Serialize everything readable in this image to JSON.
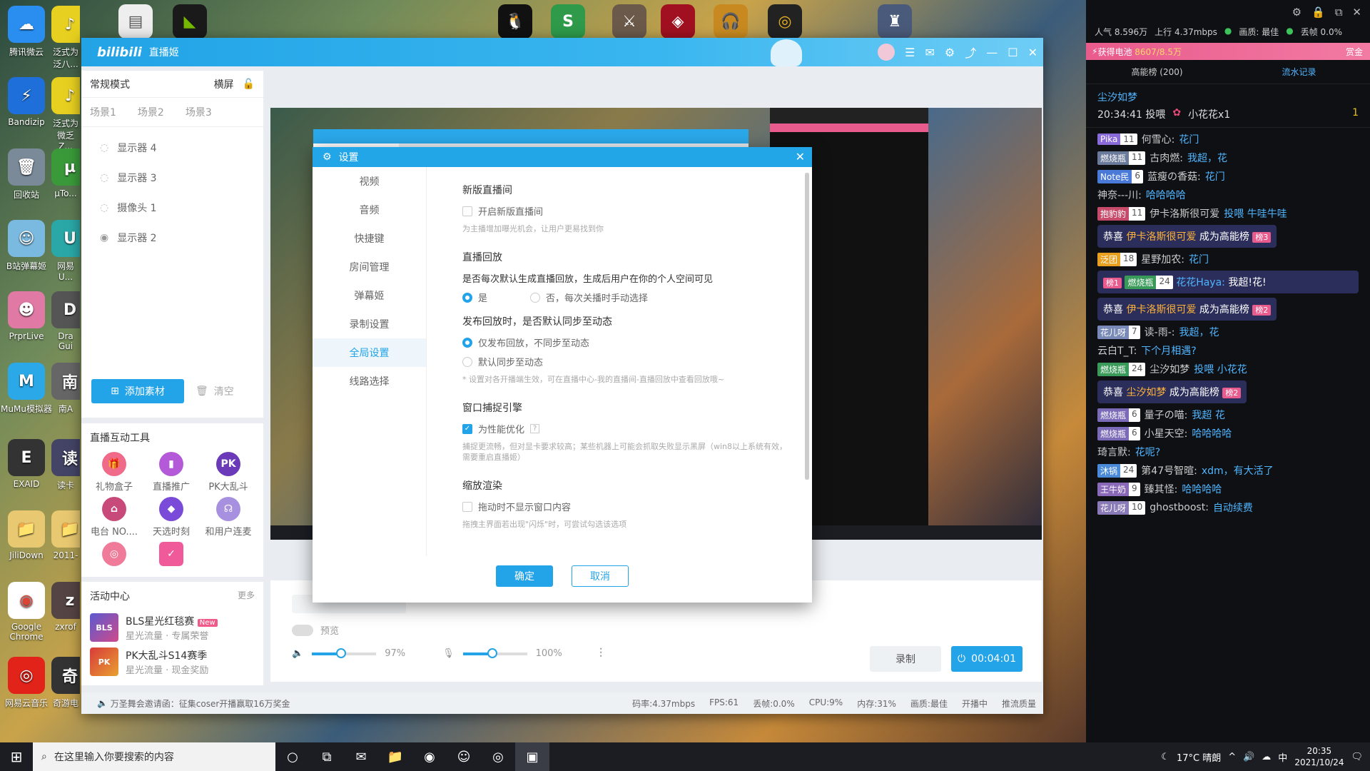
{
  "desktop": {
    "icons": [
      "腾讯微云",
      "Bandizip",
      "回收站",
      "B站弹幕姬",
      "PrprLive",
      "MuMu模拟器",
      "EXAID",
      "JiliDown",
      "Google Chrome",
      "网易云音乐"
    ],
    "icons2": [
      "泛式为泛八...",
      "泛式为微乏Z...",
      "µTo...",
      "网易U...",
      "Dra Gui",
      "南A",
      "读卡",
      "2011-",
      "zxrof",
      "奇游电"
    ]
  },
  "taskbar": {
    "search_placeholder": "在这里输入你要搜索的内容",
    "weather": "17°C 晴朗",
    "ime": "中",
    "time": "20:35",
    "date": "2021/10/24"
  },
  "window": {
    "logo": "bilibili",
    "title": "直播姬",
    "mode": "常规模式",
    "orientation": "横屏",
    "scenes": [
      "场景1",
      "场景2",
      "场景3"
    ],
    "sources": [
      "显示器 4",
      "显示器 3",
      "摄像头 1",
      "显示器 2"
    ],
    "add_label": "添加素材",
    "clear_label": "清空",
    "tools_title": "直播互动工具",
    "tools": [
      "礼物盒子",
      "直播推广",
      "PK大乱斗",
      "电台 NO....",
      "天选时刻",
      "和用户连麦"
    ],
    "activity_title": "活动中心",
    "activity_more": "更多",
    "activities": [
      {
        "title": "BLS星光红毯赛",
        "sub": "星光流量 · 专属荣誉",
        "tag": "New",
        "thumb": "BLS"
      },
      {
        "title": "PK大乱斗S14赛季",
        "sub": "星光流量 · 现金奖励",
        "tag": "",
        "thumb": "PK"
      }
    ],
    "preview_label": "预览",
    "vol": "97%",
    "mic": "100%",
    "record_label": "录制",
    "live_timer": "00:04:01",
    "status_msg": "万圣舞会邀请函：征集coser开播赢取16万奖金",
    "stats": [
      "码率:4.37mbps",
      "FPS:61",
      "丢帧:0.0%",
      "CPU:9%",
      "内存:31%",
      "画质:最佳",
      "开播中",
      "推流质量"
    ]
  },
  "dialog": {
    "title": "设置",
    "nav": [
      "视频",
      "音频",
      "快捷键",
      "房间管理",
      "弹幕姬",
      "录制设置",
      "全局设置",
      "线路选择"
    ],
    "s1": "新版直播间",
    "s1_opt": "开启新版直播间",
    "s1_hint": "为主播增加曝光机会，让用户更易找到你",
    "s2": "直播回放",
    "s2_q": "是否每次默认生成直播回放，生成后用户在你的个人空间可见",
    "s2_yes": "是",
    "s2_no": "否，每次关播时手动选择",
    "s3": "发布回放时，是否默认同步至动态",
    "s3_a": "仅发布回放，不同步至动态",
    "s3_b": "默认同步至动态",
    "s3_hint": "* 设置对各开播端生效，可在直播中心-我的直播间-直播回放中查看回放哦~",
    "s4": "窗口捕捉引擎",
    "s4_opt": "为性能优化",
    "s4_hint": "捕捉更流畅，但对显卡要求较高；某些机器上可能会抓取失败显示黑屏（win8以上系统有效，需要重启直播姬）",
    "s5": "缩放渲染",
    "s5_opt": "拖动时不显示窗口内容",
    "s5_hint": "拖拽主界面若出现\"闪烁\"时，可尝试勾选该选项",
    "ok": "确定",
    "cancel": "取消"
  },
  "chat": {
    "popularity": "人气 8.596万",
    "upload": "上行 4.37mbps",
    "quality": "画质: 最佳",
    "drop": "丢帧 0.0%",
    "battery": "获得电池",
    "battery_val": "8607/8.5万",
    "gold": "赏金",
    "tab1": "高能榜 (200)",
    "tab2": "流水记录",
    "gift_user": "尘汐如梦",
    "gift_line": "20:34:41 投喂",
    "gift_name": "小花花x1",
    "gift_count": "1",
    "messages": [
      {
        "badge": "Pika",
        "lv": "11",
        "user": "何雪心:",
        "text": "花门"
      },
      {
        "badge": "燃烧瓶",
        "lv": "11",
        "user": "古肉燃:",
        "text": "我超，花"
      },
      {
        "badge": "Note民",
        "lv": "6",
        "user": "蓝瘦の香菇:",
        "text": "花门"
      },
      {
        "badge": "",
        "lv": "",
        "user": "神奈---川:",
        "text": "哈哈哈哈"
      },
      {
        "badge": "抱豹豹",
        "lv": "11",
        "user": "伊卡洛斯很可爱",
        "text": "投喂 牛哇牛哇"
      },
      {
        "badge": "泛团",
        "lv": "18",
        "user": "星野加农:",
        "text": "花门"
      },
      {
        "badge": "花儿呀",
        "lv": "7",
        "user": "读-雨-:",
        "text": "我超，花"
      },
      {
        "badge": "",
        "lv": "",
        "user": "云白T_T:",
        "text": "下个月相遇?"
      },
      {
        "badge": "燃烧瓶",
        "lv": "24",
        "user": "尘汐如梦",
        "text": "投喂 小花花"
      },
      {
        "badge": "燃烧瓶",
        "lv": "6",
        "user": "量子の喵:",
        "text": "我超 花"
      },
      {
        "badge": "燃烧瓶",
        "lv": "6",
        "user": "小星天空:",
        "text": "哈哈哈哈"
      },
      {
        "badge": "",
        "lv": "",
        "user": "琦言默:",
        "text": "花呢?"
      },
      {
        "badge": "沐锅",
        "lv": "24",
        "user": "第47号智暄:",
        "text": "xdm，有大活了"
      },
      {
        "badge": "王牛奶",
        "lv": "9",
        "user": "臻其怪:",
        "text": "哈哈哈哈"
      },
      {
        "badge": "花儿呀",
        "lv": "10",
        "user": "ghostboost:",
        "text": "自动续费"
      }
    ],
    "hl1": {
      "pre": "恭喜",
      "name": "伊卡洛斯很可爱",
      "post": "成为高能榜",
      "rank": "榜3"
    },
    "hl2": {
      "rank": "榜1",
      "badge": "燃烧瓶",
      "lv": "24",
      "user": "花花Haya:",
      "text": "我超!花!"
    },
    "hl3": {
      "pre": "恭喜",
      "name": "伊卡洛斯很可爱",
      "post": "成为高能榜",
      "rank": "榜2"
    },
    "hl4": {
      "pre": "恭喜",
      "name": "尘汐如梦",
      "post": "成为高能榜",
      "rank": "榜2"
    }
  }
}
